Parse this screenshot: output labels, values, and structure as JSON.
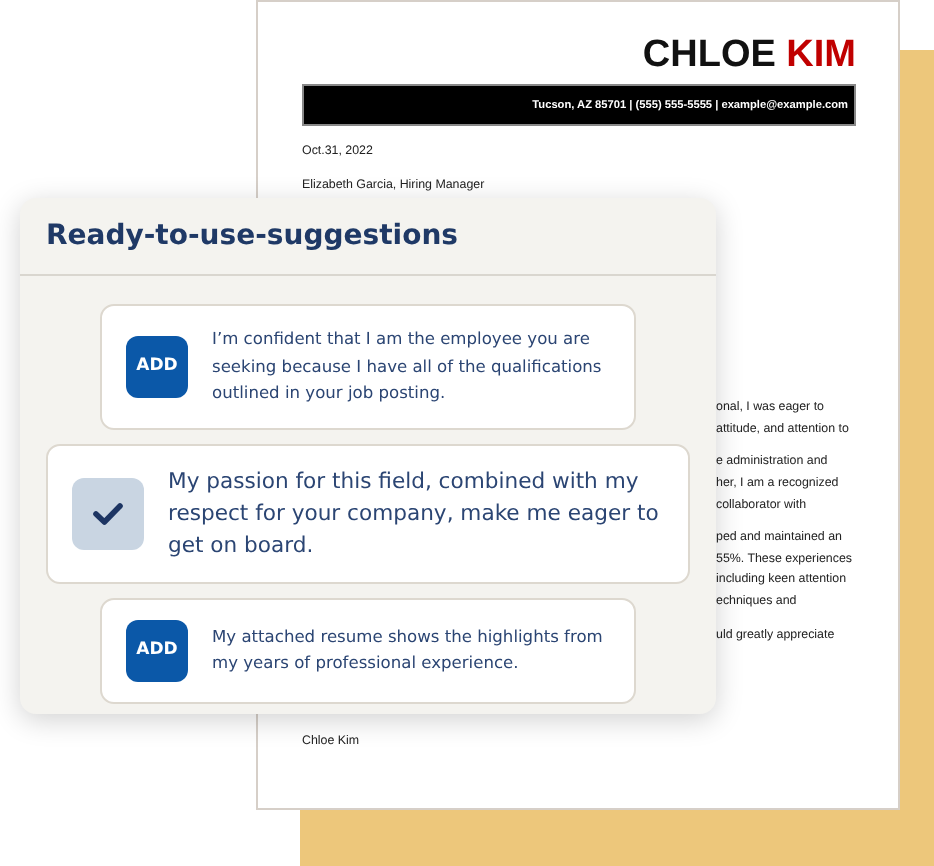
{
  "letter": {
    "name_first": "CHLOE",
    "name_last": "KIM",
    "contact": "Tucson, AZ 85701 | (555) 555-5555 | example@example.com",
    "date": "Oct.31, 2022",
    "recipient": "Elizabeth Garcia, Hiring Manager",
    "paragraphs": [
      [
        "onal, I was eager to",
        "attitude, and attention to"
      ],
      [
        "e administration and",
        "her, I am a recognized",
        "collaborator with"
      ],
      [
        "ped and maintained an",
        "55%. These experiences",
        "including keen attention",
        "echniques and"
      ],
      [
        "uld greatly appreciate"
      ]
    ],
    "signature": "Chloe Kim"
  },
  "panel": {
    "title": "Ready-to-use-suggestions",
    "suggestions": [
      {
        "text": "I’m confident that I am the employee you are seeking because I have all of the qualifications outlined in your job posting.",
        "selected": false,
        "button": "ADD"
      },
      {
        "text": "My passion for this field, combined with my respect for your company, make me eager to get on board.",
        "selected": true
      },
      {
        "text": "My attached resume shows the highlights from my years of professional experience.",
        "selected": false,
        "button": "ADD"
      }
    ]
  }
}
